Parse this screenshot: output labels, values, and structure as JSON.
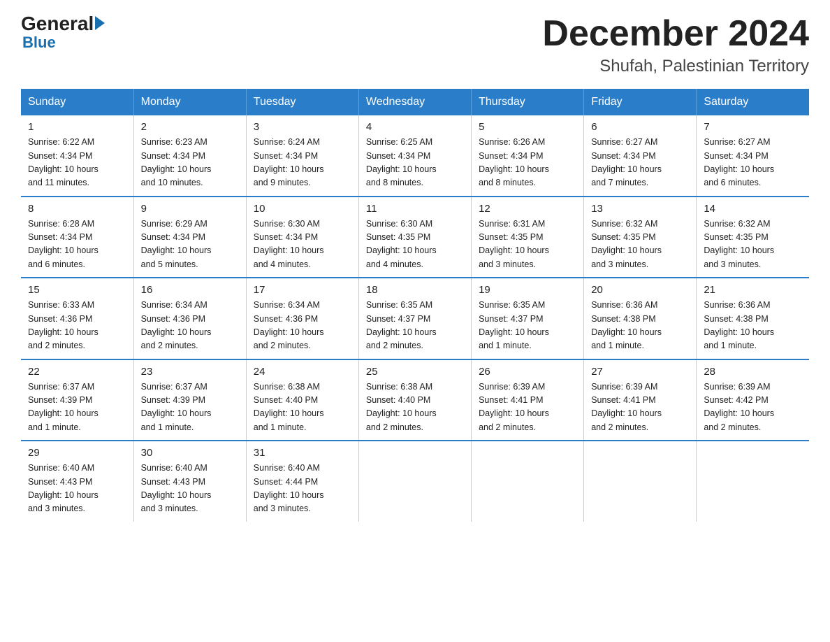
{
  "logo": {
    "general": "General",
    "blue": "Blue",
    "arrow": "►"
  },
  "title": "December 2024",
  "subtitle": "Shufah, Palestinian Territory",
  "days_of_week": [
    "Sunday",
    "Monday",
    "Tuesday",
    "Wednesday",
    "Thursday",
    "Friday",
    "Saturday"
  ],
  "weeks": [
    [
      {
        "day": "1",
        "info": "Sunrise: 6:22 AM\nSunset: 4:34 PM\nDaylight: 10 hours\nand 11 minutes."
      },
      {
        "day": "2",
        "info": "Sunrise: 6:23 AM\nSunset: 4:34 PM\nDaylight: 10 hours\nand 10 minutes."
      },
      {
        "day": "3",
        "info": "Sunrise: 6:24 AM\nSunset: 4:34 PM\nDaylight: 10 hours\nand 9 minutes."
      },
      {
        "day": "4",
        "info": "Sunrise: 6:25 AM\nSunset: 4:34 PM\nDaylight: 10 hours\nand 8 minutes."
      },
      {
        "day": "5",
        "info": "Sunrise: 6:26 AM\nSunset: 4:34 PM\nDaylight: 10 hours\nand 8 minutes."
      },
      {
        "day": "6",
        "info": "Sunrise: 6:27 AM\nSunset: 4:34 PM\nDaylight: 10 hours\nand 7 minutes."
      },
      {
        "day": "7",
        "info": "Sunrise: 6:27 AM\nSunset: 4:34 PM\nDaylight: 10 hours\nand 6 minutes."
      }
    ],
    [
      {
        "day": "8",
        "info": "Sunrise: 6:28 AM\nSunset: 4:34 PM\nDaylight: 10 hours\nand 6 minutes."
      },
      {
        "day": "9",
        "info": "Sunrise: 6:29 AM\nSunset: 4:34 PM\nDaylight: 10 hours\nand 5 minutes."
      },
      {
        "day": "10",
        "info": "Sunrise: 6:30 AM\nSunset: 4:34 PM\nDaylight: 10 hours\nand 4 minutes."
      },
      {
        "day": "11",
        "info": "Sunrise: 6:30 AM\nSunset: 4:35 PM\nDaylight: 10 hours\nand 4 minutes."
      },
      {
        "day": "12",
        "info": "Sunrise: 6:31 AM\nSunset: 4:35 PM\nDaylight: 10 hours\nand 3 minutes."
      },
      {
        "day": "13",
        "info": "Sunrise: 6:32 AM\nSunset: 4:35 PM\nDaylight: 10 hours\nand 3 minutes."
      },
      {
        "day": "14",
        "info": "Sunrise: 6:32 AM\nSunset: 4:35 PM\nDaylight: 10 hours\nand 3 minutes."
      }
    ],
    [
      {
        "day": "15",
        "info": "Sunrise: 6:33 AM\nSunset: 4:36 PM\nDaylight: 10 hours\nand 2 minutes."
      },
      {
        "day": "16",
        "info": "Sunrise: 6:34 AM\nSunset: 4:36 PM\nDaylight: 10 hours\nand 2 minutes."
      },
      {
        "day": "17",
        "info": "Sunrise: 6:34 AM\nSunset: 4:36 PM\nDaylight: 10 hours\nand 2 minutes."
      },
      {
        "day": "18",
        "info": "Sunrise: 6:35 AM\nSunset: 4:37 PM\nDaylight: 10 hours\nand 2 minutes."
      },
      {
        "day": "19",
        "info": "Sunrise: 6:35 AM\nSunset: 4:37 PM\nDaylight: 10 hours\nand 1 minute."
      },
      {
        "day": "20",
        "info": "Sunrise: 6:36 AM\nSunset: 4:38 PM\nDaylight: 10 hours\nand 1 minute."
      },
      {
        "day": "21",
        "info": "Sunrise: 6:36 AM\nSunset: 4:38 PM\nDaylight: 10 hours\nand 1 minute."
      }
    ],
    [
      {
        "day": "22",
        "info": "Sunrise: 6:37 AM\nSunset: 4:39 PM\nDaylight: 10 hours\nand 1 minute."
      },
      {
        "day": "23",
        "info": "Sunrise: 6:37 AM\nSunset: 4:39 PM\nDaylight: 10 hours\nand 1 minute."
      },
      {
        "day": "24",
        "info": "Sunrise: 6:38 AM\nSunset: 4:40 PM\nDaylight: 10 hours\nand 1 minute."
      },
      {
        "day": "25",
        "info": "Sunrise: 6:38 AM\nSunset: 4:40 PM\nDaylight: 10 hours\nand 2 minutes."
      },
      {
        "day": "26",
        "info": "Sunrise: 6:39 AM\nSunset: 4:41 PM\nDaylight: 10 hours\nand 2 minutes."
      },
      {
        "day": "27",
        "info": "Sunrise: 6:39 AM\nSunset: 4:41 PM\nDaylight: 10 hours\nand 2 minutes."
      },
      {
        "day": "28",
        "info": "Sunrise: 6:39 AM\nSunset: 4:42 PM\nDaylight: 10 hours\nand 2 minutes."
      }
    ],
    [
      {
        "day": "29",
        "info": "Sunrise: 6:40 AM\nSunset: 4:43 PM\nDaylight: 10 hours\nand 3 minutes."
      },
      {
        "day": "30",
        "info": "Sunrise: 6:40 AM\nSunset: 4:43 PM\nDaylight: 10 hours\nand 3 minutes."
      },
      {
        "day": "31",
        "info": "Sunrise: 6:40 AM\nSunset: 4:44 PM\nDaylight: 10 hours\nand 3 minutes."
      },
      {
        "day": "",
        "info": ""
      },
      {
        "day": "",
        "info": ""
      },
      {
        "day": "",
        "info": ""
      },
      {
        "day": "",
        "info": ""
      }
    ]
  ]
}
